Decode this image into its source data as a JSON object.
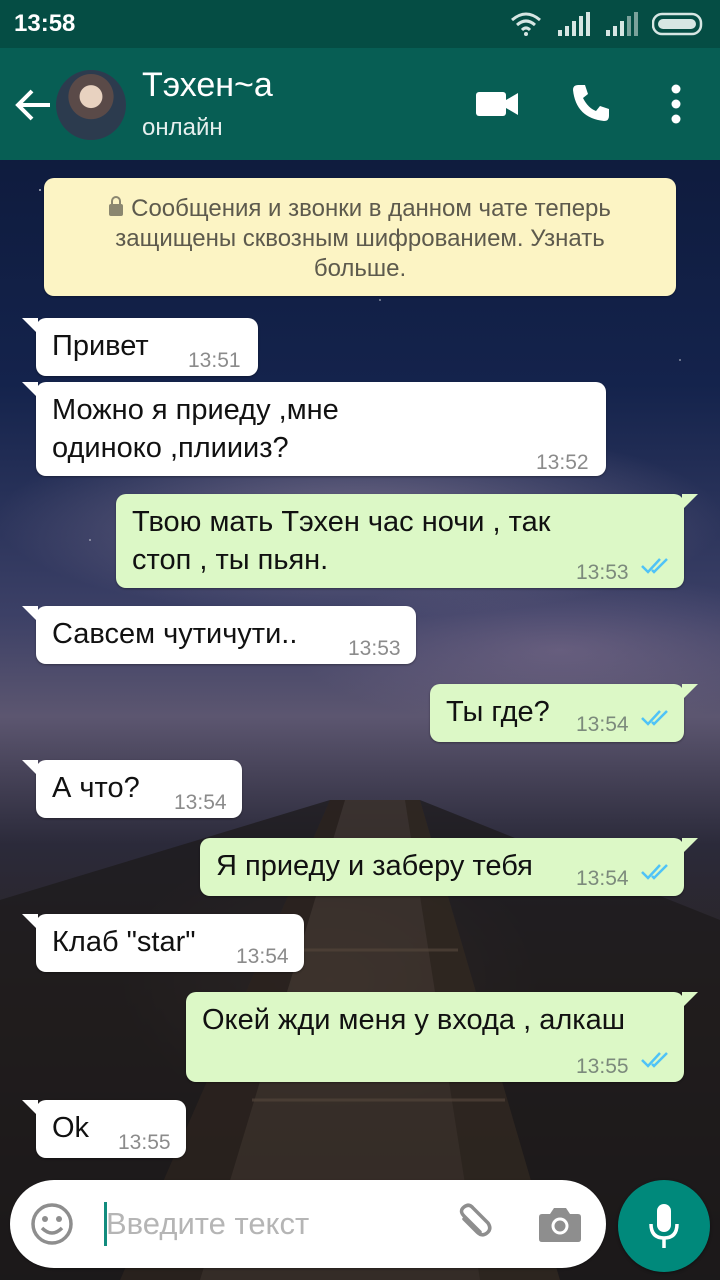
{
  "status_bar": {
    "time": "13:58"
  },
  "header": {
    "contact_name": "Тэхен~а",
    "contact_status": "онлайн"
  },
  "system_message": {
    "text": "Сообщения и звонки в данном чате теперь защищены сквозным шифрованием. Узнать больше."
  },
  "messages": [
    {
      "direction": "in",
      "line1": "Привет",
      "line2": "",
      "time": "13:51"
    },
    {
      "direction": "in",
      "line1": "Можно я приеду ,мне",
      "line2": "одиноко ,плиииз?",
      "time": "13:52"
    },
    {
      "direction": "out",
      "line1": "Твою мать Тэхен час ночи , так",
      "line2": "стоп , ты пьян.",
      "time": "13:53",
      "status": "read"
    },
    {
      "direction": "in",
      "line1": "Савсем чутичути..",
      "line2": "",
      "time": "13:53"
    },
    {
      "direction": "out",
      "line1": "Ты где?",
      "line2": "",
      "time": "13:54",
      "status": "read"
    },
    {
      "direction": "in",
      "line1": "А что?",
      "line2": "",
      "time": "13:54"
    },
    {
      "direction": "out",
      "line1": "Я приеду и заберу тебя",
      "line2": "",
      "time": "13:54",
      "status": "read"
    },
    {
      "direction": "in",
      "line1": "Клаб \"star\"",
      "line2": "",
      "time": "13:54"
    },
    {
      "direction": "out",
      "line1": "Окей жди меня у входа , алкаш",
      "line2": "",
      "time": "13:55",
      "status": "read"
    },
    {
      "direction": "in",
      "line1": "Ok",
      "line2": "",
      "time": "13:55"
    }
  ],
  "input": {
    "placeholder": "Введите текст"
  },
  "icons": {
    "back": "arrow-left-icon",
    "video": "video-camera-icon",
    "call": "phone-icon",
    "menu": "more-vertical-icon",
    "emoji": "smiley-icon",
    "attach": "paperclip-icon",
    "camera": "camera-icon",
    "mic": "microphone-icon"
  },
  "colors": {
    "header": "#075e54",
    "statusbar": "#054d44",
    "incoming": "#ffffff",
    "outgoing": "#dcf8c6",
    "system": "#fcf4c4",
    "read_ticks": "#4fc3f7",
    "mic_button": "#00897b"
  }
}
